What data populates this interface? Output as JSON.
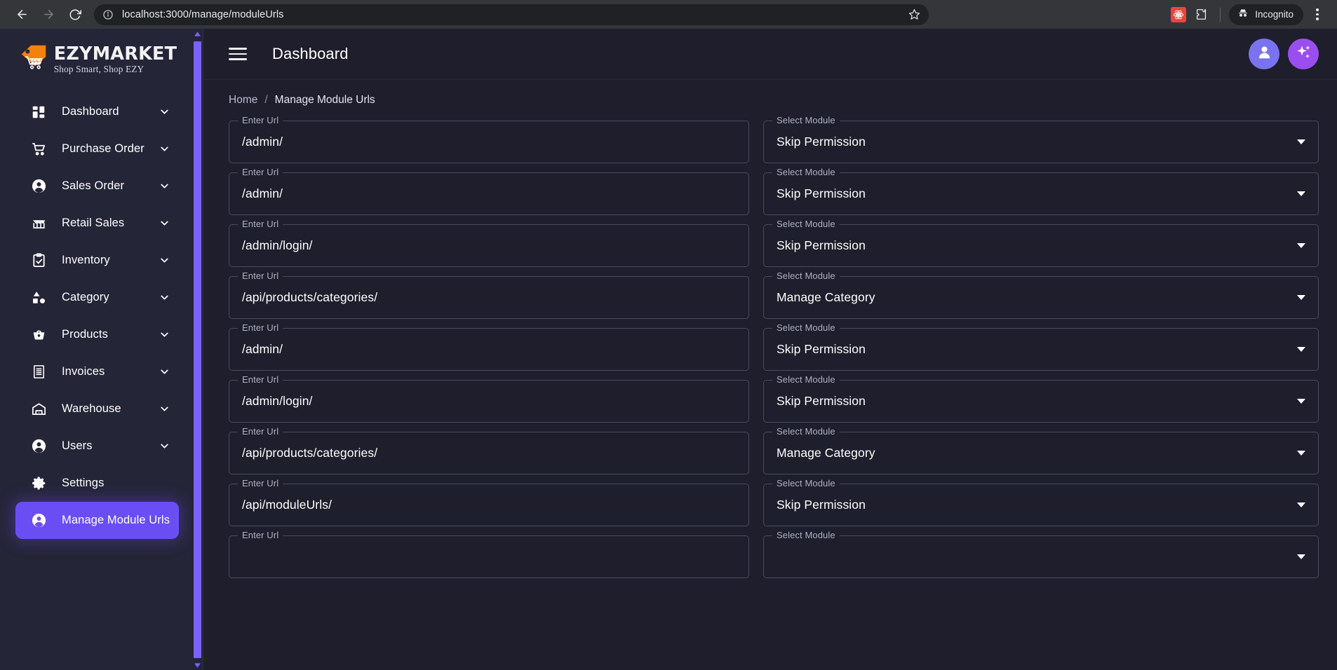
{
  "browser": {
    "back_icon": "arrow-left-icon",
    "forward_icon": "arrow-right-icon",
    "reload_icon": "reload-icon",
    "site_info_icon": "info-circle-icon",
    "url": "localhost:3000/manage/moduleUrls",
    "bookmark_icon": "star-icon",
    "extension_icon": "react-devtools-extension-icon",
    "extensions_puzzle_icon": "puzzle-piece-icon",
    "incognito_label": "Incognito",
    "incognito_icon": "incognito-hat-icon",
    "menu_icon": "kebab-menu-icon"
  },
  "sidebar": {
    "logo": {
      "icon": "price-tag-cart-icon",
      "title": "EZYMARKET",
      "tagline": "Shop Smart, Shop EZY"
    },
    "items": [
      {
        "label": "Dashboard",
        "icon": "dashboard-grid-icon",
        "chevron": "chevron-down-icon",
        "active": false
      },
      {
        "label": "Purchase Order",
        "icon": "shopping-cart-icon",
        "chevron": "chevron-down-icon",
        "active": false
      },
      {
        "label": "Sales Order",
        "icon": "user-circle-icon",
        "chevron": "chevron-down-icon",
        "active": false
      },
      {
        "label": "Retail Sales",
        "icon": "storefront-icon",
        "chevron": "chevron-down-icon",
        "active": false
      },
      {
        "label": "Inventory",
        "icon": "clipboard-check-icon",
        "chevron": "chevron-down-icon",
        "active": false
      },
      {
        "label": "Category",
        "icon": "shapes-icon",
        "chevron": "chevron-down-icon",
        "active": false
      },
      {
        "label": "Products",
        "icon": "basket-icon",
        "chevron": "chevron-down-icon",
        "active": false
      },
      {
        "label": "Invoices",
        "icon": "receipt-icon",
        "chevron": "chevron-down-icon",
        "active": false
      },
      {
        "label": "Warehouse",
        "icon": "warehouse-icon",
        "chevron": "chevron-down-icon",
        "active": false
      },
      {
        "label": "Users",
        "icon": "user-circle-icon",
        "chevron": "chevron-down-icon",
        "active": false
      },
      {
        "label": "Settings",
        "icon": "gear-icon",
        "chevron": "",
        "active": false
      },
      {
        "label": "Manage Module Urls",
        "icon": "user-circle-icon",
        "chevron": "",
        "active": true
      }
    ],
    "active_color": "#6a4ef4",
    "background": "#252538",
    "scrollbar_color": "#7b61ff"
  },
  "topbar": {
    "menu_icon": "hamburger-menu-icon",
    "title": "Dashboard",
    "user_avatar_icon": "user-circle-icon",
    "ai_sparkle_icon": "sparkles-icon",
    "user_avatar_color": "#7b72f0",
    "ai_button_color": "#9b4ef0"
  },
  "breadcrumb": {
    "home": "Home",
    "separator": "/",
    "current": "Manage Module Urls"
  },
  "form": {
    "url_label": "Enter Url",
    "module_label": "Select Module",
    "dropdown_icon": "caret-down-icon",
    "rows": [
      {
        "url": "/admin/",
        "module": "Skip Permission"
      },
      {
        "url": "/admin/",
        "module": "Skip Permission"
      },
      {
        "url": "/admin/login/",
        "module": "Skip Permission"
      },
      {
        "url": "/api/products/categories/",
        "module": "Manage Category"
      },
      {
        "url": "/admin/",
        "module": "Skip Permission"
      },
      {
        "url": "/admin/login/",
        "module": "Skip Permission"
      },
      {
        "url": "/api/products/categories/",
        "module": "Manage Category"
      },
      {
        "url": "/api/moduleUrls/",
        "module": "Skip Permission"
      },
      {
        "url": "",
        "module": ""
      }
    ]
  }
}
